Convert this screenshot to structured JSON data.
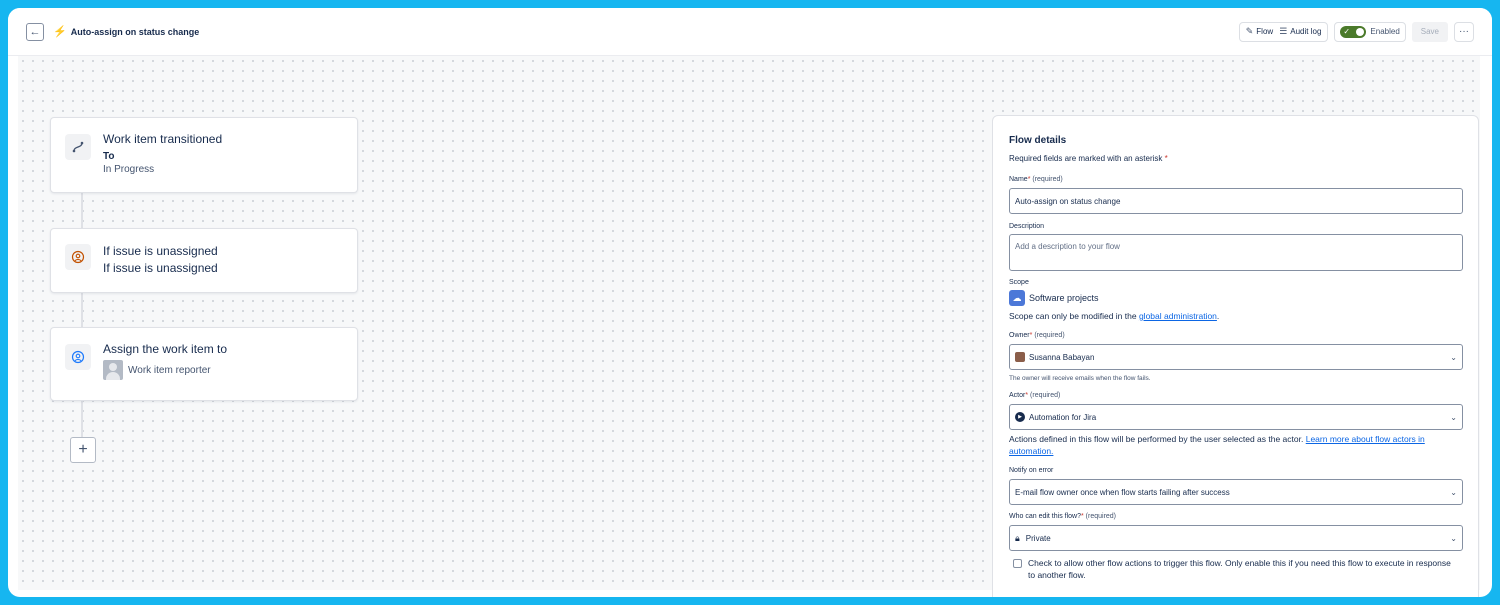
{
  "header": {
    "title": "Auto-assign on status change",
    "back_icon": "arrow-left-icon",
    "flow_tab": "Flow",
    "audit_tab": "Audit log",
    "enabled_label": "Enabled",
    "save_label": "Save",
    "more_label": "···"
  },
  "flow": {
    "trigger": {
      "title": "Work item transitioned",
      "sub_bold": "To",
      "sub": "In Progress"
    },
    "condition": {
      "line1": "If issue is unassigned",
      "line2": "If issue is unassigned"
    },
    "action": {
      "title": "Assign the work item to",
      "sub": "Work item reporter"
    },
    "add_label": "+"
  },
  "panel": {
    "title": "Flow details",
    "required_note": "Required fields are marked with an asterisk",
    "asterisk": "*",
    "name_label": "Name",
    "required_tag": "(required)",
    "name_value": "Auto-assign on status change",
    "description_label": "Description",
    "description_placeholder": "Add a description to your flow",
    "scope_label": "Scope",
    "scope_value": "Software projects",
    "scope_note_prefix": "Scope can only be modified in the ",
    "scope_note_link": "global administration",
    "scope_note_suffix": ".",
    "owner_label": "Owner",
    "owner_value": "Susanna Babayan",
    "owner_helper": "The owner will receive emails when the flow fails.",
    "actor_label": "Actor",
    "actor_value": "Automation for Jira",
    "actions_note_prefix": "Actions defined in this flow will be performed by the user selected as the actor. ",
    "actions_note_link": "Learn more about flow actors in automation.",
    "notify_label": "Notify on error",
    "notify_value": "E-mail flow owner once when flow starts failing after success",
    "edit_label": "Who can edit this flow?",
    "edit_value": "Private",
    "checkbox_label": "Check to allow other flow actions to trigger this flow. Only enable this if you need this flow to execute in response to another flow."
  },
  "colors": {
    "accent": "#0c66e4",
    "toggle": "#4b7a2a",
    "frame": "#16b6f0"
  }
}
